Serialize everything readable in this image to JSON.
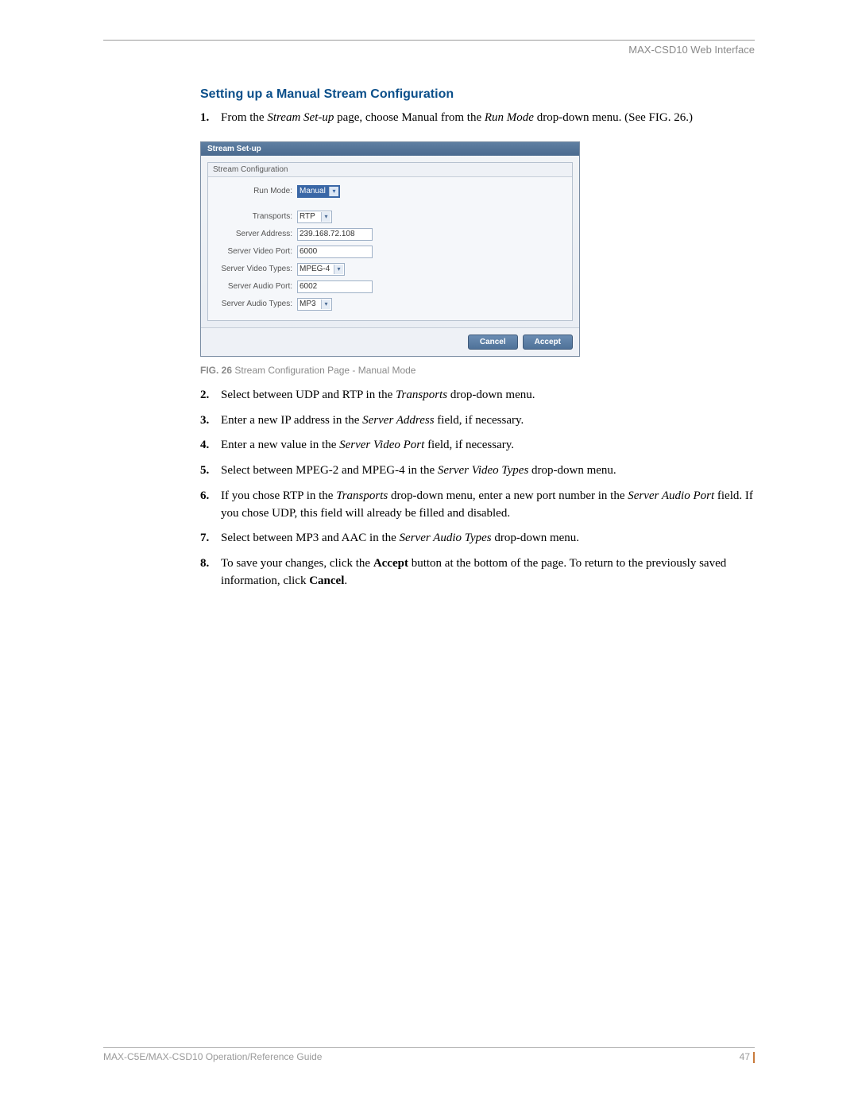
{
  "header": {
    "label": "MAX-CSD10 Web Interface"
  },
  "section": {
    "title": "Setting up a Manual Stream Configuration"
  },
  "steps": {
    "s1": {
      "num": "1.",
      "pre": "From the ",
      "i1": "Stream Set-up",
      "mid": " page, choose Manual from the ",
      "i2": "Run Mode",
      "post": " drop-down menu. (See FIG. 26.)"
    },
    "s2": {
      "num": "2.",
      "pre": "Select between UDP and RTP in the ",
      "i1": "Transports",
      "post": " drop-down menu."
    },
    "s3": {
      "num": "3.",
      "pre": "Enter a new IP address in the ",
      "i1": "Server Address",
      "post": " field, if necessary."
    },
    "s4": {
      "num": "4.",
      "pre": "Enter a new value in the ",
      "i1": "Server Video Port",
      "post": " field, if necessary."
    },
    "s5": {
      "num": "5.",
      "pre": "Select between MPEG-2 and MPEG-4 in the ",
      "i1": "Server Video Types",
      "post": " drop-down menu."
    },
    "s6": {
      "num": "6.",
      "pre": "If you chose RTP in the ",
      "i1": "Transports",
      "mid": " drop-down menu, enter a new port number in the ",
      "i2": "Server Audio Port",
      "post": " field. If you chose UDP, this field will already be filled and disabled."
    },
    "s7": {
      "num": "7.",
      "pre": "Select between MP3 and AAC in the ",
      "i1": "Server Audio Types",
      "post": " drop-down menu."
    },
    "s8": {
      "num": "8.",
      "pre": "To save your changes, click the ",
      "b1": "Accept",
      "mid": " button at the bottom of the page. To return to the previously saved information, click ",
      "b2": "Cancel",
      "post": "."
    }
  },
  "figure": {
    "titlebar": "Stream Set-up",
    "panel_title": "Stream Configuration",
    "labels": {
      "runmode": "Run Mode:",
      "transports": "Transports:",
      "server_address": "Server Address:",
      "server_video_port": "Server Video Port:",
      "server_video_types": "Server Video Types:",
      "server_audio_port": "Server Audio Port:",
      "server_audio_types": "Server Audio Types:"
    },
    "values": {
      "runmode": "Manual",
      "transports": "RTP",
      "server_address": "239.168.72.108",
      "server_video_port": "6000",
      "server_video_types": "MPEG-4",
      "server_audio_port": "6002",
      "server_audio_types": "MP3"
    },
    "buttons": {
      "cancel": "Cancel",
      "accept": "Accept"
    },
    "caption_prefix": "FIG. 26",
    "caption_text": "  Stream Configuration Page - Manual Mode"
  },
  "footer": {
    "guide": "MAX-C5E/MAX-CSD10 Operation/Reference Guide",
    "page": "47"
  }
}
